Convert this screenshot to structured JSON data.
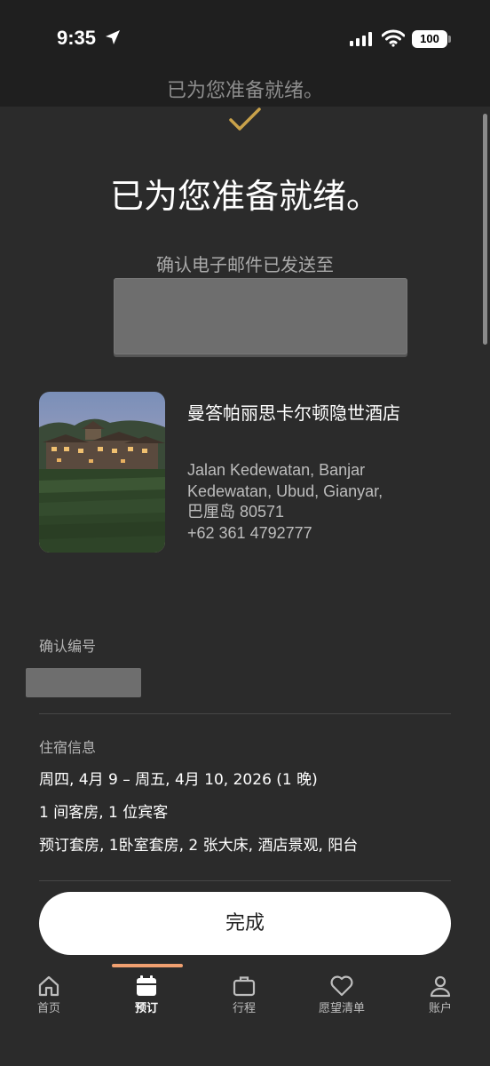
{
  "status_bar": {
    "time": "9:35",
    "battery": "100",
    "icons": [
      "location-arrow-icon",
      "cellular-signal-icon",
      "wifi-icon",
      "battery-icon"
    ]
  },
  "header": {
    "sticky_title": "已为您准备就绪。"
  },
  "confirmation": {
    "title": "已为您准备就绪。",
    "email_sent_label": "确认电子邮件已发送至",
    "checkmark_color": "#c9a24a"
  },
  "hotel": {
    "name": "曼答帕丽思卡尔顿隐世酒店",
    "address_lines": [
      "Jalan Kedewatan, Banjar",
      "Kedewatan, Ubud, Gianyar,",
      "巴厘岛 80571",
      "+62 361 4792777"
    ]
  },
  "booking": {
    "confirmation_number_label": "确认编号",
    "stay_info_label": "住宿信息",
    "dates": "周四, 4月 9 – 周五, 4月 10, 2026 (1 晚)",
    "rooms_guests": "1 间客房, 1 位宾客",
    "room_type": "预订套房, 1卧室套房, 2 张大床, 酒店景观, 阳台"
  },
  "actions": {
    "done_label": "完成"
  },
  "tab_bar": {
    "accent_color": "#f0a070",
    "tabs": [
      {
        "label": "首页",
        "icon": "home-icon"
      },
      {
        "label": "预订",
        "icon": "calendar-icon",
        "active": true
      },
      {
        "label": "行程",
        "icon": "briefcase-icon"
      },
      {
        "label": "愿望清单",
        "icon": "heart-icon"
      },
      {
        "label": "账户",
        "icon": "person-icon"
      }
    ]
  }
}
